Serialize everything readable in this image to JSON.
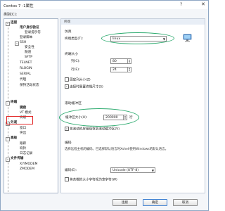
{
  "window": {
    "title": "Centos 7 -1属性",
    "help": "?",
    "close": "✕"
  },
  "category_label": "类别(C):",
  "tree": {
    "connection": "连接",
    "user_auth": "用户身份验证",
    "login_prompt": "登录提示符",
    "login_script": "登录脚本",
    "ssh": "SSH",
    "security": "安全性",
    "tunnel": "隧道",
    "sftp": "SFTP",
    "telnet": "TELNET",
    "rlogin": "RLOGIN",
    "serial": "SERIAL",
    "proxy": "代理",
    "keepalive": "保持活动状态",
    "terminal": "终端",
    "keyboard": "键盘",
    "vt_modes": "VT 模式",
    "advanced_t": "高级",
    "appearance": "外观",
    "window_item": "窗口",
    "highlight": "突出",
    "advanced": "高级",
    "trace": "跟踪",
    "bell": "响铃",
    "logging": "日志记录",
    "file_transfer": "文件传输",
    "xymodem": "X/YMODEM",
    "zmodem": "ZMODEM"
  },
  "panel": {
    "header": "终端",
    "emulation_title": "仿真",
    "terminal_type_label": "终端类型(T):",
    "terminal_type_value": "linux",
    "terminal_size_title": "终端大小",
    "cols_label": "列(C):",
    "cols_value": "80",
    "rows_label": "行(E):",
    "rows_value": "24",
    "fixed_size": "固定列大小(Z)",
    "sync_size": "连接时重置终端尺寸(S)",
    "scroll_title": "滚动缓冲区",
    "buffer_label": "缓冲区大小(U):",
    "buffer_value": "200000",
    "buffer_unit": "行",
    "scroll_to_bottom": "将滚动的屏幕保存到滚动缓冲区(V)",
    "encoding_title": "编码",
    "encoding_desc": "选择远程主机的编码。已选择默认语言时Xshell使用Windows的默认语言。",
    "encoding_label": "编码(E):",
    "encoding_value": "Unicode (UTF-8)",
    "ambiguous": "将含糊的大小字符视为宽字符(W)"
  },
  "buttons": {
    "connect": "连接",
    "ok": "确定",
    "cancel": "取消"
  },
  "colors": {
    "accent_ring": "#29a96c",
    "highlight_box": "#e32b2b"
  },
  "icons": {
    "monitor": "monitor-icon"
  }
}
